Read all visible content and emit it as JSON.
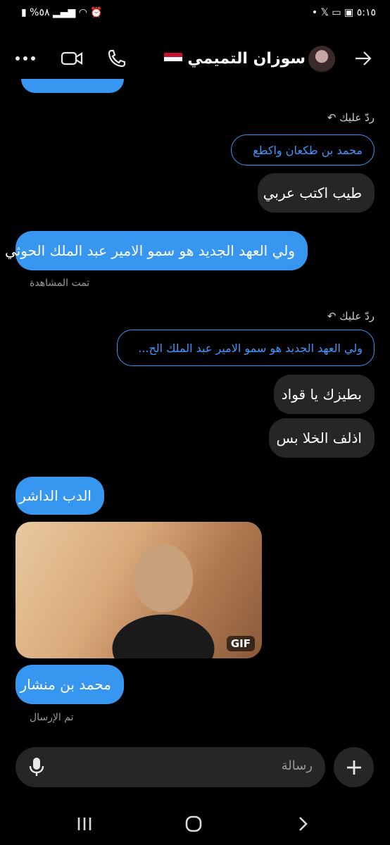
{
  "status_bar": {
    "time": "٥:١٥",
    "battery": "%٥٨"
  },
  "header": {
    "contact_name": "سوزان التميمي",
    "back_icon": "arrow-right-icon",
    "call_icon": "phone-icon",
    "video_icon": "video-icon",
    "more_icon": "more-icon"
  },
  "messages": {
    "reply_label_1": "ردّ عليك",
    "reply_quote_1": "محمد   بن طكعان واكطع",
    "incoming_1": "طيب اكتب عربي",
    "outgoing_1": "ولي العهد الجديد هو سمو الامير عبد الملك الحوثي",
    "seen_label": "تمت المشاهدة",
    "reply_label_2": "ردّ عليك",
    "reply_quote_2": "ولي العهد الجديد هو سمو الامير عبد الملك الح...",
    "incoming_2": "بطيزك يا قواد",
    "incoming_3": "اذلف الخلا بس",
    "outgoing_2": "الدب الداشر",
    "gif_badge": "GIF",
    "outgoing_3": "محمد بن منشار",
    "sent_label": "تم الإرسال"
  },
  "composer": {
    "placeholder": "رسالة"
  },
  "colors": {
    "outgoing_bubble": "#3797f0",
    "incoming_bubble": "#262626",
    "background": "#000000"
  }
}
